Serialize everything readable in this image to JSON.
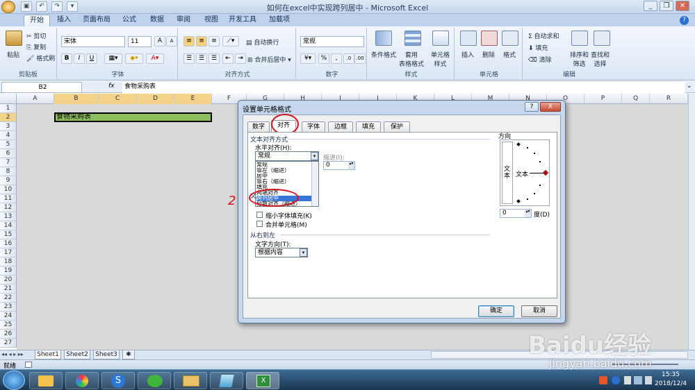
{
  "window": {
    "title": "如何在excel中实现跨列居中 - Microsoft Excel"
  },
  "ribbon_tabs": [
    "开始",
    "插入",
    "页面布局",
    "公式",
    "数据",
    "审阅",
    "视图",
    "开发工具",
    "加载项"
  ],
  "clipboard": {
    "paste": "粘贴",
    "cut": "剪切",
    "copy": "复制",
    "format_painter": "格式刷",
    "label": "剪贴板"
  },
  "font": {
    "name": "宋体",
    "size": "11",
    "label": "字体",
    "bold": "B",
    "italic": "I",
    "underline": "U",
    "grow": "A",
    "shrink": "A"
  },
  "alignment": {
    "wrap": "自动换行",
    "merge": "合并后居中",
    "label": "对齐方式"
  },
  "number": {
    "format": "常规",
    "label": "数字",
    "percent": "%",
    "comma": ","
  },
  "styles": {
    "conditional": "条件格式",
    "table": "套用\n表格格式",
    "cell": "单元格\n样式",
    "label": "样式"
  },
  "cells": {
    "insert": "插入",
    "delete": "删除",
    "format": "格式",
    "label": "单元格"
  },
  "editing": {
    "autosum": "Σ 自动求和",
    "fill": "填充",
    "clear": "清除",
    "sort": "排序和\n筛选",
    "find": "查找和\n选择",
    "label": "编辑"
  },
  "formula_bar": {
    "name_box": "B2",
    "fx": "fx",
    "content": "食物采购表"
  },
  "columns": [
    "A",
    "B",
    "C",
    "D",
    "E",
    "F",
    "G",
    "H",
    "I",
    "J",
    "K",
    "L",
    "M",
    "N",
    "O",
    "P",
    "Q",
    "R"
  ],
  "rows": [
    "1",
    "2",
    "3",
    "4",
    "5",
    "6",
    "7",
    "8",
    "9",
    "10",
    "11",
    "12",
    "13",
    "14",
    "15",
    "16",
    "17",
    "18",
    "19",
    "20",
    "21",
    "22",
    "23",
    "24",
    "25",
    "26",
    "27"
  ],
  "cell_b2": "食物采购表",
  "sheets": [
    "Sheet1",
    "Sheet2",
    "Sheet3"
  ],
  "status": {
    "ready": "就绪"
  },
  "taskbar": {
    "time": "15:35",
    "date": "2018/12/4"
  },
  "dialog": {
    "title": "设置单元格格式",
    "help": "?",
    "close": "X",
    "tabs": [
      "数字",
      "对齐",
      "字体",
      "边框",
      "填充",
      "保护"
    ],
    "text_align_section": "文本对齐方式",
    "horizontal_label": "水平对齐(H):",
    "horizontal_value": "常规",
    "indent_label": "缩进(I):",
    "indent_value": "0",
    "list_items": [
      "常规",
      "靠左（缩进）",
      "居中",
      "靠右（缩进）",
      "填充",
      "两端对齐",
      "跨列居中",
      "分散对齐（缩进）"
    ],
    "text_control_fragment": "文",
    "shrink_label": "缩小字体填充(K)",
    "merge_label": "合并单元格(M)",
    "rtl_section": "从右到左",
    "direction_label": "文字方向(T):",
    "direction_value": "根据内容",
    "orientation_label": "方向",
    "vertical_text": "文本",
    "horizontal_text": "文本",
    "degree_value": "0",
    "degree_label": "度(D)",
    "ok": "确定",
    "cancel": "取消"
  },
  "annotation": {
    "mark": "2"
  },
  "watermark": {
    "brand": "Baidu经验",
    "url": "jingyan.baidu.com"
  },
  "colors": {
    "accent": "#1f4e8c",
    "selection": "#8dbf5f",
    "red": "#d2151d"
  }
}
